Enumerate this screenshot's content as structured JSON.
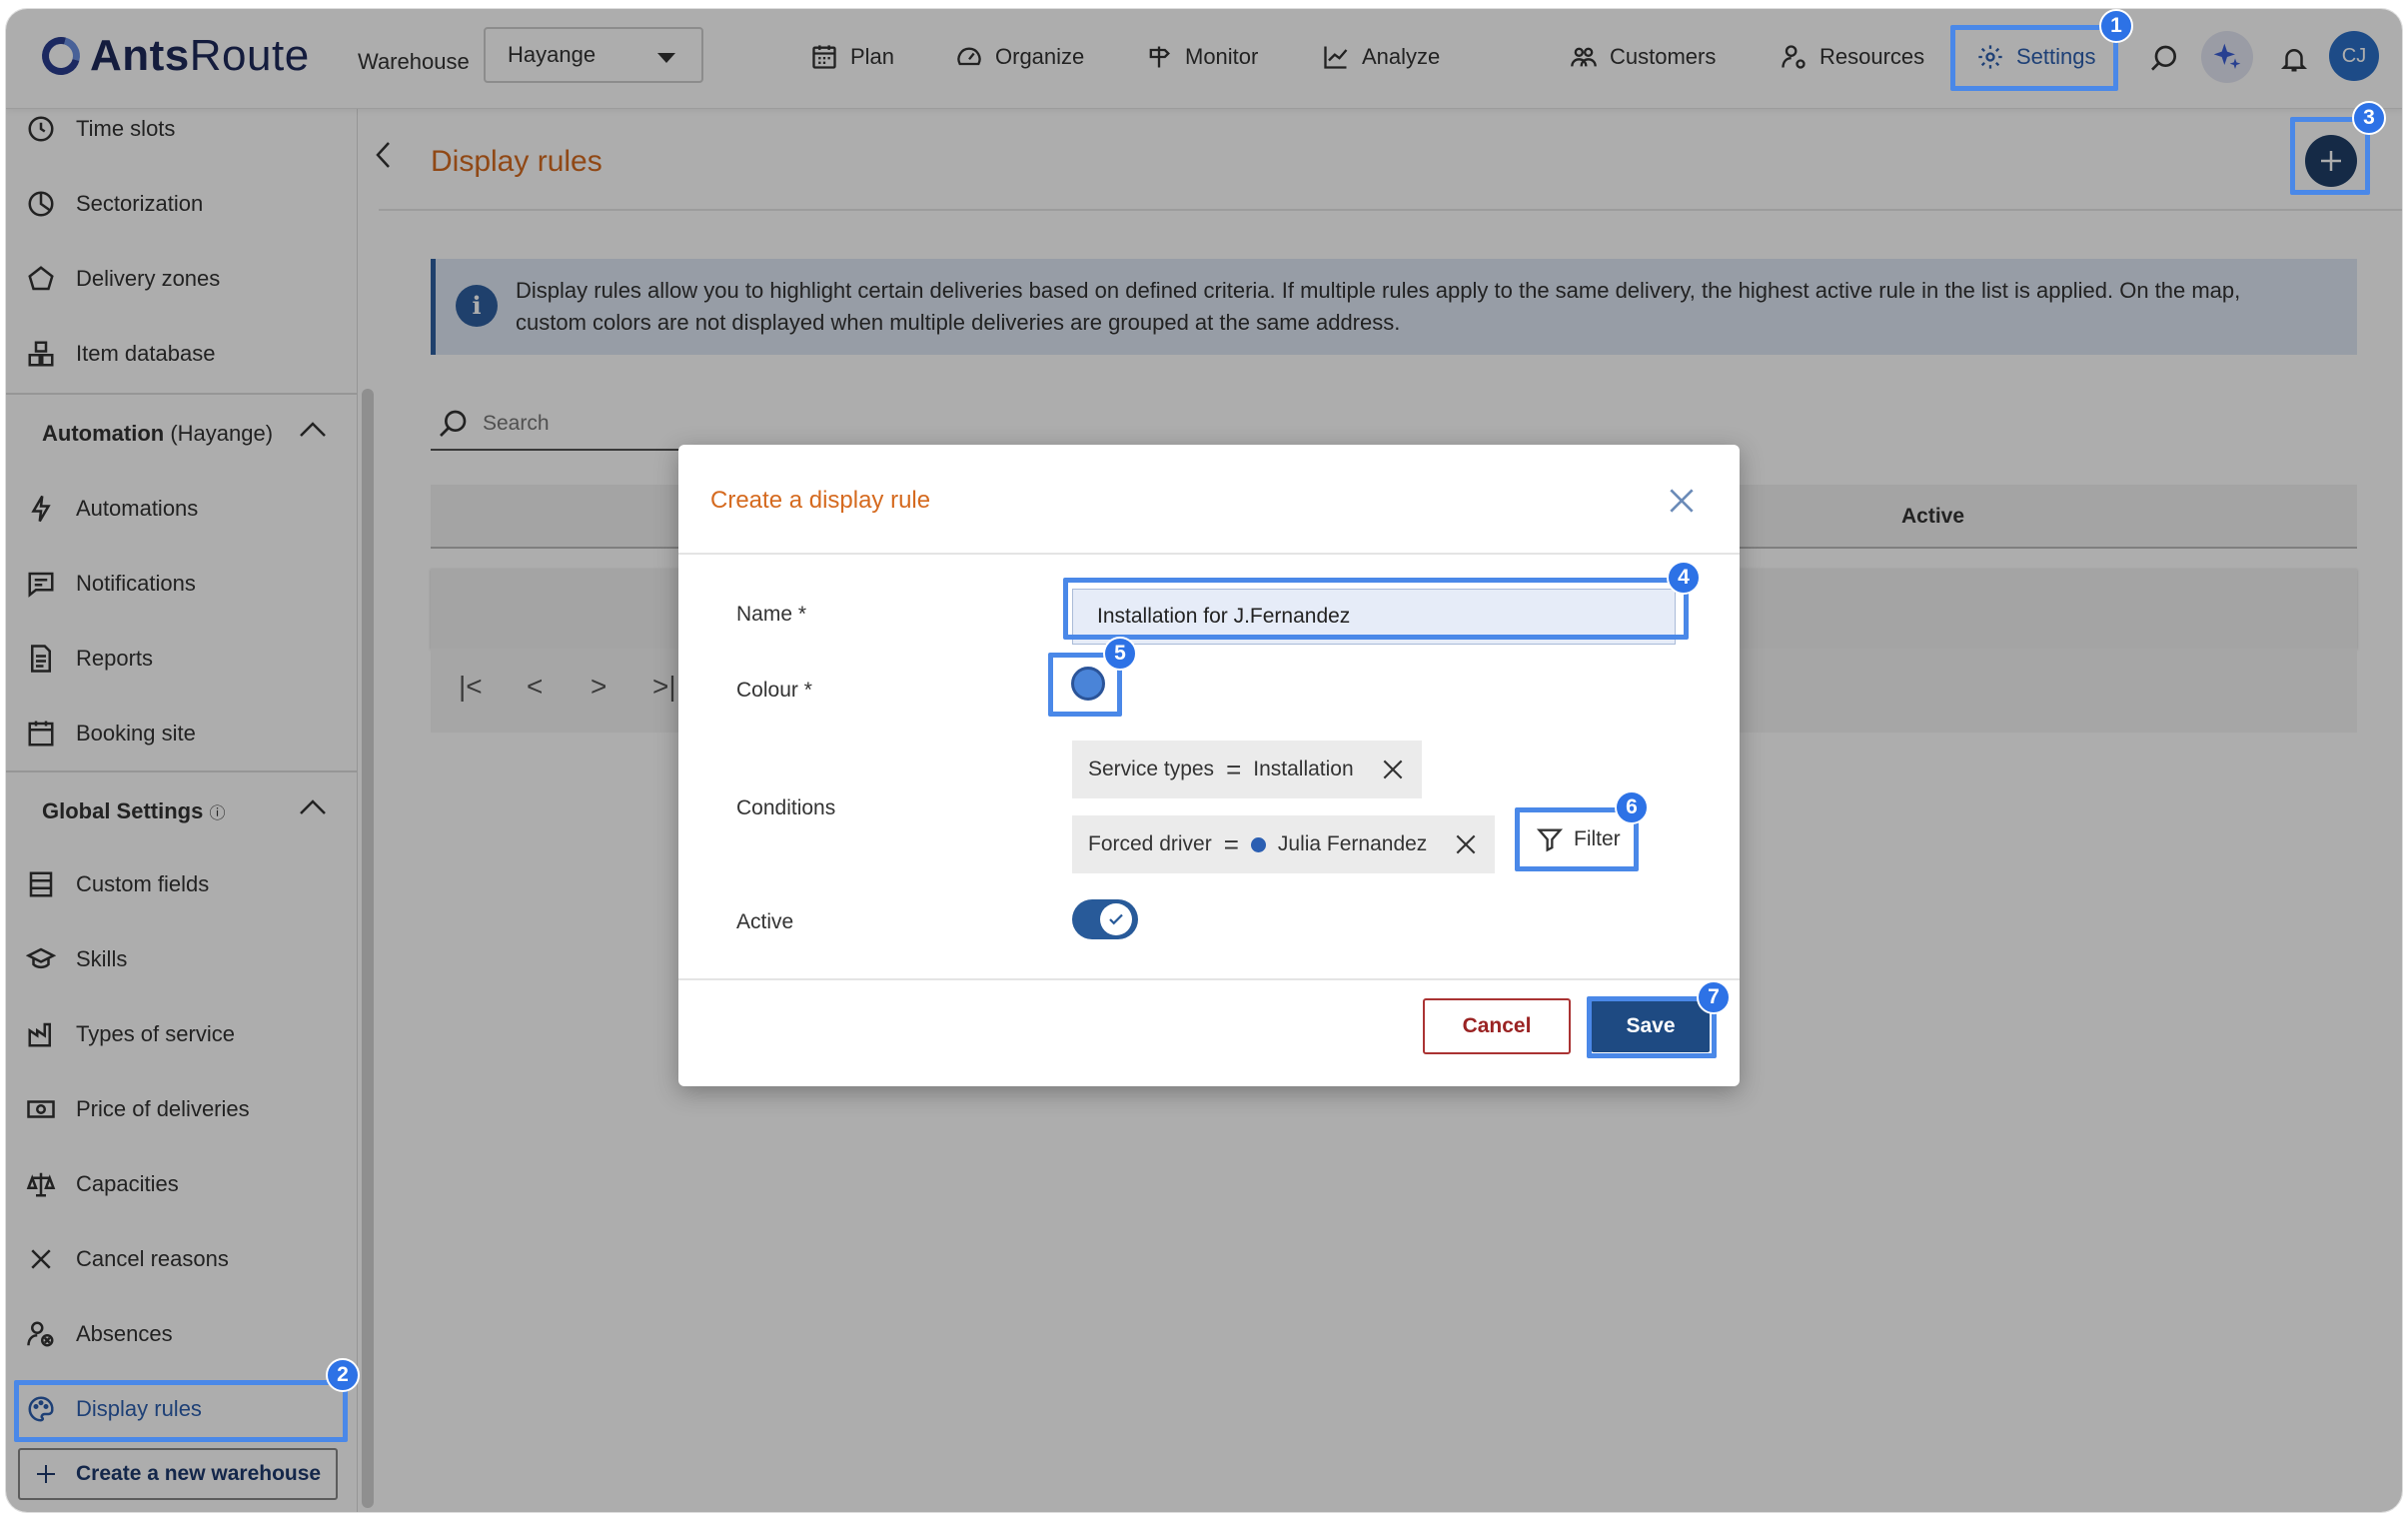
{
  "app": {
    "logo_bold": "Ants",
    "logo_light": "Route"
  },
  "header": {
    "warehouse_label": "Warehouse",
    "warehouse_value": "Hayange",
    "nav": [
      "Plan",
      "Organize",
      "Monitor",
      "Analyze",
      "Customers",
      "Resources",
      "Settings"
    ],
    "avatar_initials": "CJ"
  },
  "sidebar": {
    "items_top": [
      "Time slots",
      "Sectorization",
      "Delivery zones",
      "Item database"
    ],
    "automation_title": "Automation",
    "automation_suffix": "(Hayange)",
    "automation_items": [
      "Automations",
      "Notifications",
      "Reports",
      "Booking site"
    ],
    "global_title": "Global Settings",
    "global_items": [
      "Custom fields",
      "Skills",
      "Types of service",
      "Price of deliveries",
      "Capacities",
      "Cancel reasons",
      "Absences",
      "Display rules"
    ],
    "create_warehouse": "Create a new warehouse"
  },
  "main": {
    "title": "Display rules",
    "info": "Display rules allow you to highlight certain deliveries based on defined criteria. If multiple rules apply to the same delivery, the highest active rule in the list is applied. On the map, custom colors are not displayed when multiple deliveries are grouped at the same address.",
    "search_placeholder": "Search",
    "table_headers": {
      "active": "Active"
    }
  },
  "modal": {
    "title": "Create a display rule",
    "name_label": "Name *",
    "name_value": "Installation for J.Fernandez",
    "colour_label": "Colour *",
    "colour_value": "#4a84d8",
    "conditions_label": "Conditions",
    "conditions": [
      {
        "field": "Service types",
        "op": "=",
        "value": "Installation"
      },
      {
        "field": "Forced driver",
        "op": "=",
        "value": "Julia Fernandez"
      }
    ],
    "filter_label": "Filter",
    "active_label": "Active",
    "active_value": true,
    "cancel_label": "Cancel",
    "save_label": "Save"
  },
  "annotations": [
    "1",
    "2",
    "3",
    "4",
    "5",
    "6",
    "7"
  ],
  "colors": {
    "accent": "#4a88e8",
    "title": "#d56a1f",
    "primary": "#1e4a82"
  }
}
